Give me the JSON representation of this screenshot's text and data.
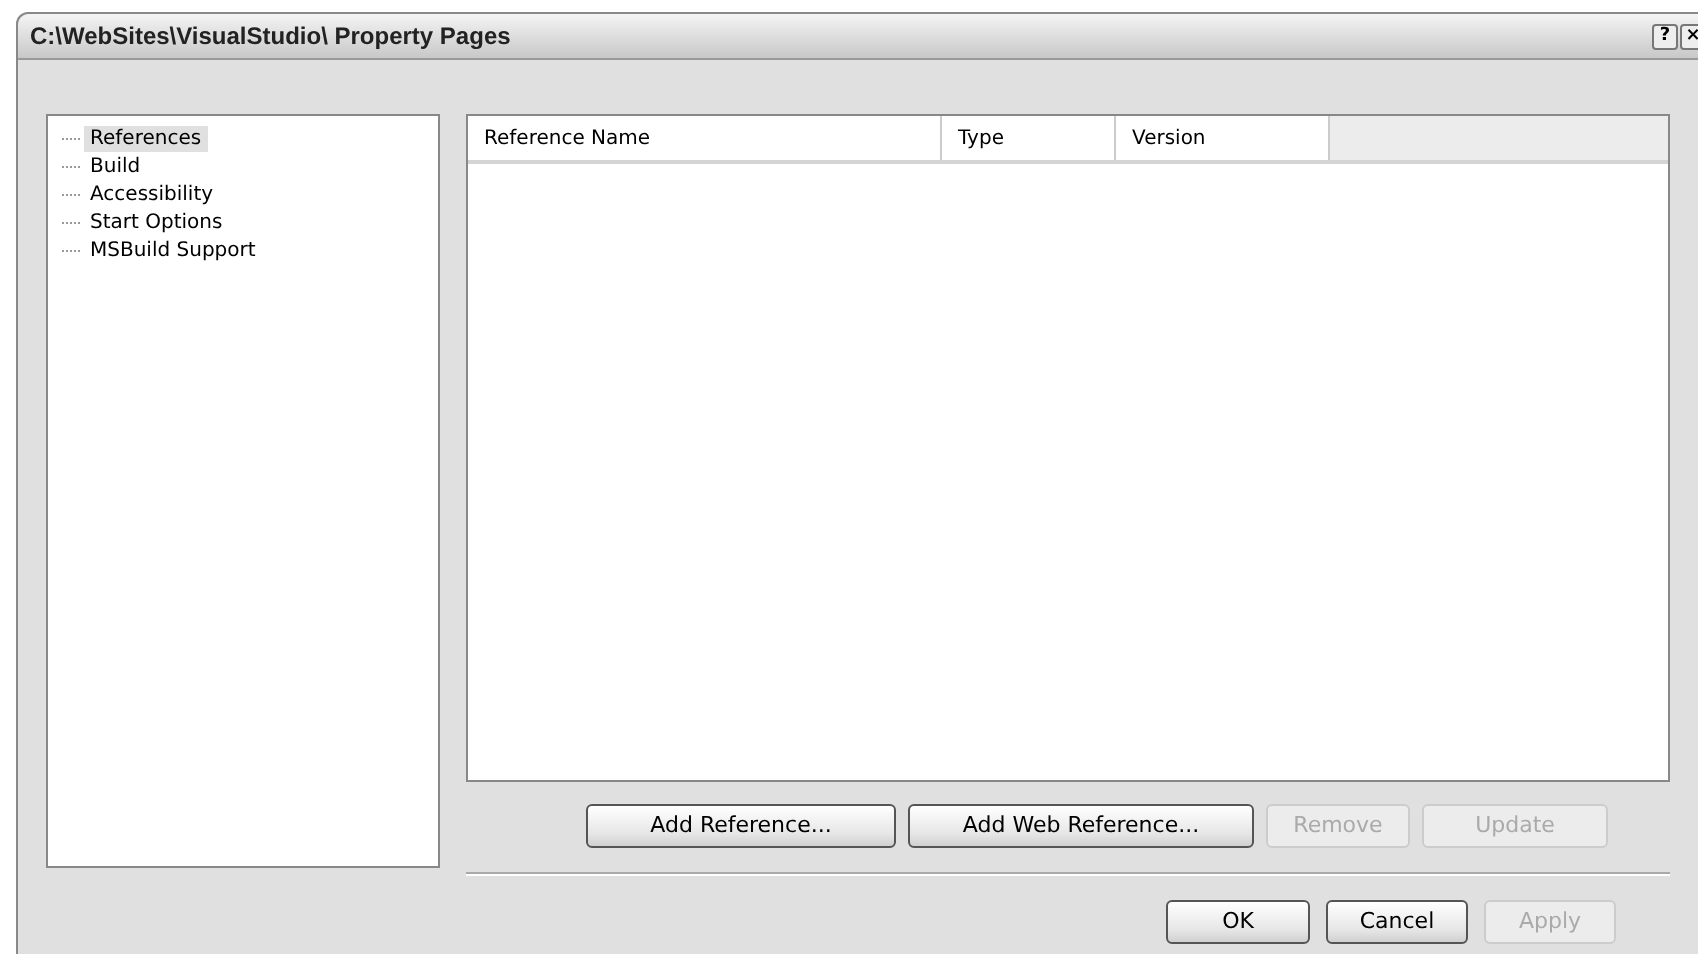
{
  "window": {
    "title": "C:\\WebSites\\VisualStudio\\ Property Pages",
    "buttons": [
      "?",
      "×"
    ]
  },
  "sidebar": {
    "items": [
      {
        "label": "References",
        "selected": true
      },
      {
        "label": "Build",
        "selected": false
      },
      {
        "label": "Accessibility",
        "selected": false
      },
      {
        "label": "Start Options",
        "selected": false
      },
      {
        "label": "MSBuild Support",
        "selected": false
      }
    ]
  },
  "table": {
    "columns": [
      "Reference Name",
      "Type",
      "Version"
    ]
  },
  "reference_buttons": [
    {
      "label": "Add Reference...",
      "disabled": false
    },
    {
      "label": "Add Web Reference...",
      "disabled": false
    },
    {
      "label": "Remove",
      "disabled": true
    },
    {
      "label": "Update",
      "disabled": true
    }
  ],
  "dialog_buttons": [
    {
      "label": "OK",
      "disabled": false
    },
    {
      "label": "Cancel",
      "disabled": false
    },
    {
      "label": "Apply",
      "disabled": true
    }
  ]
}
